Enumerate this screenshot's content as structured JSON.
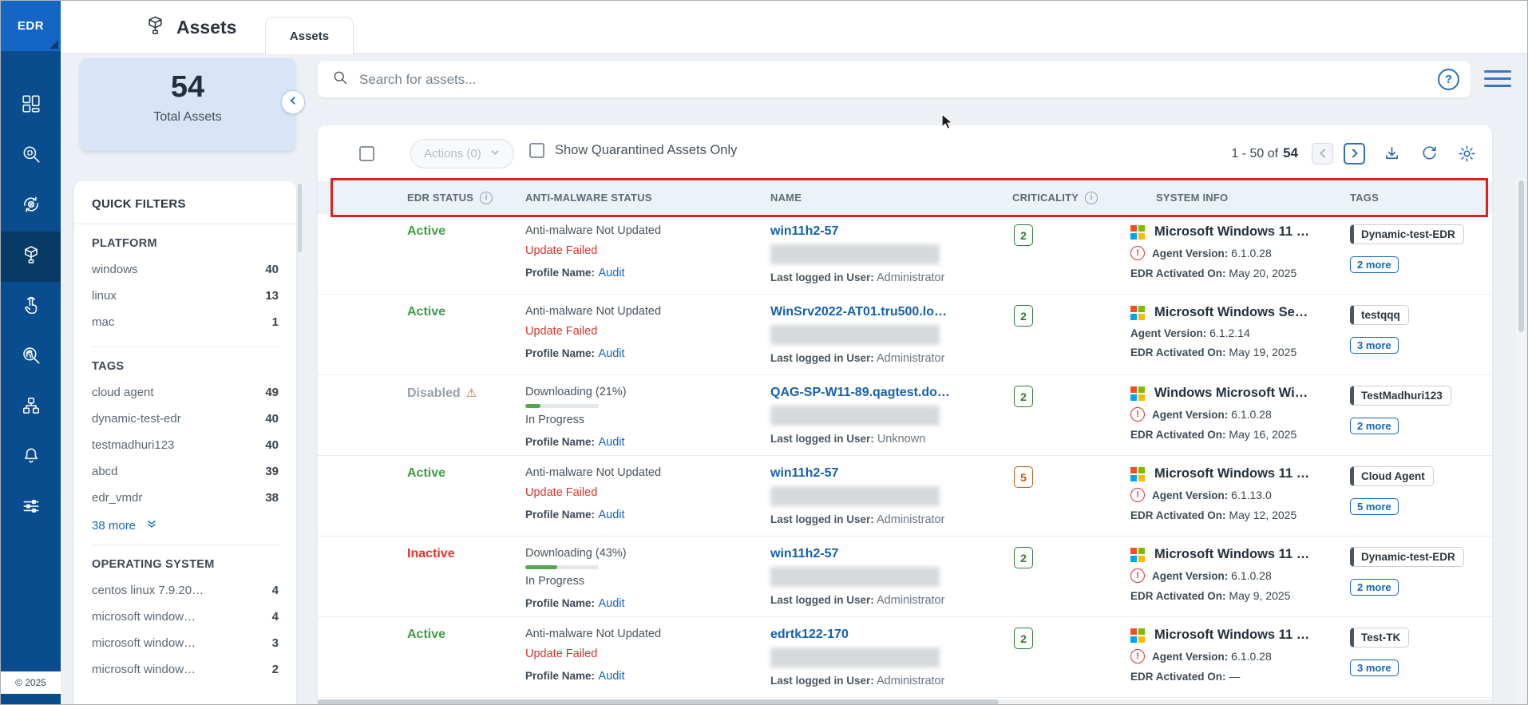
{
  "app": {
    "name": "EDR",
    "copyright": "© 2025"
  },
  "sidebar": {
    "selected_icon": "assets-icon",
    "icons": [
      "dashboard-grid-icon",
      "search-icon",
      "quarantine-sync-icon",
      "assets-icon",
      "tap-icon",
      "fingerprint-search-icon",
      "hierarchy-icon",
      "bell-icon",
      "sliders-icon"
    ]
  },
  "header": {
    "title": "Assets",
    "tab_label": "Assets"
  },
  "summary": {
    "count": "54",
    "label": "Total Assets"
  },
  "filters": {
    "title": "QUICK FILTERS",
    "sections": [
      {
        "title": "PLATFORM",
        "items": [
          {
            "label": "windows",
            "count": "40"
          },
          {
            "label": "linux",
            "count": "13"
          },
          {
            "label": "mac",
            "count": "1"
          }
        ]
      },
      {
        "title": "TAGS",
        "items": [
          {
            "label": "cloud agent",
            "count": "49"
          },
          {
            "label": "dynamic-test-edr",
            "count": "40"
          },
          {
            "label": "testmadhuri123",
            "count": "40"
          },
          {
            "label": "abcd",
            "count": "39"
          },
          {
            "label": "edr_vmdr",
            "count": "38"
          }
        ],
        "more_label": "38 more"
      },
      {
        "title": "OPERATING SYSTEM",
        "items": [
          {
            "label": "centos linux 7.9.20…",
            "count": "4"
          },
          {
            "label": "microsoft window…",
            "count": "4"
          },
          {
            "label": "microsoft window…",
            "count": "3"
          },
          {
            "label": "microsoft window…",
            "count": "2"
          }
        ]
      }
    ]
  },
  "toolbar": {
    "search_placeholder": "Search for assets...",
    "actions_label": "Actions (0)",
    "quarantine_label": "Show Quarantined Assets Only",
    "range_label": "1 - 50 of",
    "range_total": "54",
    "icons": [
      "help-icon",
      "hamburger-icon",
      "prev-page-icon",
      "next-page-icon",
      "download-icon",
      "refresh-icon",
      "gear-icon"
    ]
  },
  "table": {
    "columns": [
      {
        "label": "EDR STATUS",
        "info": true
      },
      {
        "label": "ANTI-MALWARE STATUS",
        "info": false
      },
      {
        "label": "NAME",
        "info": false
      },
      {
        "label": "CRITICALITY",
        "info": true
      },
      {
        "label": "SYSTEM INFO",
        "info": false
      },
      {
        "label": "TAGS",
        "info": false
      }
    ],
    "labels": {
      "profile": "Profile Name:",
      "last_user": "Last logged in User:",
      "agent": "Agent Version:",
      "activated": "EDR Activated On:"
    },
    "rows": [
      {
        "edr_status": "Active",
        "edr_status_type": "active",
        "edr_warning": false,
        "anti_malware": {
          "line1": "Anti-malware Not Updated",
          "line2": "Update Failed",
          "line2_type": "error",
          "progress_pct": null,
          "profile_value": "Audit"
        },
        "name": "win11h2-57",
        "last_user": "Administrator",
        "criticality": "2",
        "criticality_level": "low",
        "system": {
          "os": "Microsoft Windows 11 …",
          "agent_warning": true,
          "agent_version": "6.1.0.28",
          "activated_value": "May 20, 2025"
        },
        "tags": {
          "primary": "Dynamic-test-EDR",
          "more": "2 more"
        }
      },
      {
        "edr_status": "Active",
        "edr_status_type": "active",
        "edr_warning": false,
        "anti_malware": {
          "line1": "Anti-malware Not Updated",
          "line2": "Update Failed",
          "line2_type": "error",
          "progress_pct": null,
          "profile_value": "Audit"
        },
        "name": "WinSrv2022-AT01.tru500.lo…",
        "last_user": "Administrator",
        "criticality": "2",
        "criticality_level": "low",
        "system": {
          "os": "Microsoft Windows Se…",
          "agent_warning": false,
          "agent_version": "6.1.2.14",
          "activated_value": "May 19, 2025"
        },
        "tags": {
          "primary": "testqqq",
          "more": "3 more"
        }
      },
      {
        "edr_status": "Disabled",
        "edr_status_type": "disabled",
        "edr_warning": true,
        "anti_malware": {
          "line1": "Downloading (21%)",
          "line2": "In Progress",
          "line2_type": "normal",
          "progress_pct": 21,
          "profile_value": "Audit"
        },
        "name": "QAG-SP-W11-89.qagtest.do…",
        "last_user": "Unknown",
        "criticality": "2",
        "criticality_level": "low",
        "system": {
          "os": "Windows Microsoft Wi…",
          "agent_warning": true,
          "agent_version": "6.1.0.28",
          "activated_value": "May 16, 2025"
        },
        "tags": {
          "primary": "TestMadhuri123",
          "more": "2 more"
        }
      },
      {
        "edr_status": "Active",
        "edr_status_type": "active",
        "edr_warning": false,
        "anti_malware": {
          "line1": "Anti-malware Not Updated",
          "line2": "Update Failed",
          "line2_type": "error",
          "progress_pct": null,
          "profile_value": "Audit"
        },
        "name": "win11h2-57",
        "last_user": "Administrator",
        "criticality": "5",
        "criticality_level": "high",
        "system": {
          "os": "Microsoft Windows 11 …",
          "agent_warning": true,
          "agent_version": "6.1.13.0",
          "activated_value": "May 12, 2025"
        },
        "tags": {
          "primary": "Cloud Agent",
          "more": "5 more"
        }
      },
      {
        "edr_status": "Inactive",
        "edr_status_type": "inactive",
        "edr_warning": false,
        "anti_malware": {
          "line1": "Downloading (43%)",
          "line2": "In Progress",
          "line2_type": "normal",
          "progress_pct": 43,
          "profile_value": "Audit"
        },
        "name": "win11h2-57",
        "last_user": "Administrator",
        "criticality": "2",
        "criticality_level": "low",
        "system": {
          "os": "Microsoft Windows 11 …",
          "agent_warning": true,
          "agent_version": "6.1.0.28",
          "activated_value": "May 9, 2025"
        },
        "tags": {
          "primary": "Dynamic-test-EDR",
          "more": "2 more"
        }
      },
      {
        "edr_status": "Active",
        "edr_status_type": "active",
        "edr_warning": false,
        "anti_malware": {
          "line1": "Anti-malware Not Updated",
          "line2": "Update Failed",
          "line2_type": "error",
          "progress_pct": null,
          "profile_value": "Audit"
        },
        "name": "edrtk122-170",
        "last_user": "Administrator",
        "criticality": "2",
        "criticality_level": "low",
        "system": {
          "os": "Microsoft Windows 11 …",
          "agent_warning": true,
          "agent_version": "6.1.0.28",
          "activated_value": "—"
        },
        "tags": {
          "primary": "Test-TK",
          "more": "3 more"
        }
      }
    ]
  },
  "colors": {
    "sidebar": "#0a4d8e",
    "logo": "#1566c4",
    "accent": "#1467b8",
    "active_green": "#3f9d42",
    "inactive_red": "#e2342b",
    "disabled_gray": "#98a1ab",
    "annotation_red": "#e01f1f",
    "crit_low": "#2e7d32",
    "crit_high": "#bf5e17",
    "win_logo": [
      "#f25022",
      "#7fba00",
      "#00a4ef",
      "#ffb900"
    ]
  }
}
